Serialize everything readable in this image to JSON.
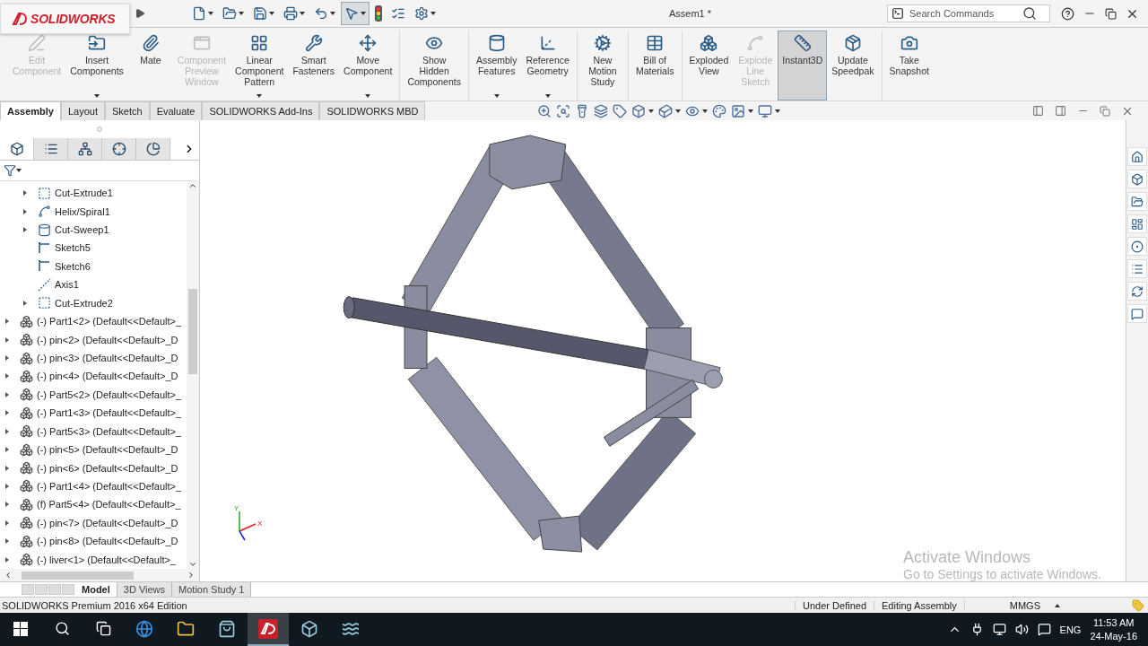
{
  "logo": "SOLIDWORKS",
  "title": "Assem1 *",
  "search": {
    "placeholder": "Search Commands"
  },
  "quick_tools": [
    {
      "kind": "new",
      "menu": true,
      "selected": false
    },
    {
      "kind": "open",
      "menu": true,
      "selected": false
    },
    {
      "kind": "save",
      "menu": true,
      "selected": false
    },
    {
      "kind": "print",
      "menu": true,
      "selected": false
    },
    {
      "kind": "undo",
      "menu": true,
      "selected": false
    },
    {
      "kind": "select",
      "menu": true,
      "selected": true
    },
    {
      "kind": "rebuild",
      "menu": false,
      "selected": false
    },
    {
      "kind": "options-list",
      "menu": false,
      "selected": false
    },
    {
      "kind": "settings",
      "menu": true,
      "selected": false
    }
  ],
  "ribbon_groups": [
    {
      "buttons": [
        {
          "label": "Edit Component",
          "kind": "edit",
          "disabled": true,
          "menu": false,
          "selected": false
        },
        {
          "label": "Insert Components",
          "kind": "insert",
          "disabled": false,
          "menu": true,
          "selected": false
        },
        {
          "label": "Mate",
          "kind": "mate",
          "disabled": false,
          "menu": false,
          "selected": false
        },
        {
          "label": "Component Preview Window",
          "kind": "preview",
          "disabled": true,
          "menu": false,
          "selected": false
        },
        {
          "label": "Linear Component Pattern",
          "kind": "pattern",
          "disabled": false,
          "menu": true,
          "selected": false
        },
        {
          "label": "Smart Fasteners",
          "kind": "fasteners",
          "disabled": false,
          "menu": false,
          "selected": false
        },
        {
          "label": "Move Component",
          "kind": "move",
          "disabled": false,
          "menu": true,
          "selected": false
        }
      ]
    },
    {
      "buttons": [
        {
          "label": "Show Hidden Components",
          "kind": "hidden",
          "disabled": false,
          "menu": false,
          "selected": false
        }
      ]
    },
    {
      "buttons": [
        {
          "label": "Assembly Features",
          "kind": "features",
          "disabled": false,
          "menu": true,
          "selected": false
        },
        {
          "label": "Reference Geometry",
          "kind": "geometry",
          "disabled": false,
          "menu": true,
          "selected": false
        }
      ]
    },
    {
      "buttons": [
        {
          "label": "New Motion Study",
          "kind": "motion",
          "disabled": false,
          "menu": false,
          "selected": false
        }
      ]
    },
    {
      "buttons": [
        {
          "label": "Bill of Materials",
          "kind": "bom",
          "disabled": false,
          "menu": false,
          "selected": false
        }
      ]
    },
    {
      "buttons": [
        {
          "label": "Exploded View",
          "kind": "explode",
          "disabled": false,
          "menu": false,
          "selected": false
        },
        {
          "label": "Explode Line Sketch",
          "kind": "explodeline",
          "disabled": true,
          "menu": false,
          "selected": false
        },
        {
          "label": "Instant3D",
          "kind": "instant3d",
          "disabled": false,
          "menu": false,
          "selected": true
        },
        {
          "label": "Update Speedpak",
          "kind": "speedpak",
          "disabled": false,
          "menu": false,
          "selected": false
        }
      ]
    },
    {
      "buttons": [
        {
          "label": "Take Snapshot",
          "kind": "snapshot",
          "disabled": false,
          "menu": false,
          "selected": false
        }
      ]
    }
  ],
  "command_tabs": [
    {
      "label": "Assembly",
      "selected": true
    },
    {
      "label": "Layout",
      "selected": false
    },
    {
      "label": "Sketch",
      "selected": false
    },
    {
      "label": "Evaluate",
      "selected": false
    },
    {
      "label": "SOLIDWORKS Add-Ins",
      "selected": false
    },
    {
      "label": "SOLIDWORKS MBD",
      "selected": false
    }
  ],
  "panel_tabs": [
    {
      "kind": "feature-manager",
      "selected": true
    },
    {
      "kind": "property-manager",
      "selected": false
    },
    {
      "kind": "configuration-manager",
      "selected": false
    },
    {
      "kind": "dimxpert",
      "selected": false
    },
    {
      "kind": "display-manager",
      "selected": false
    }
  ],
  "tree": {
    "features": [
      {
        "label": "Cut-Extrude1",
        "kind": "cut",
        "expandable": true
      },
      {
        "label": "Helix/Spiral1",
        "kind": "helix",
        "expandable": true
      },
      {
        "label": "Cut-Sweep1",
        "kind": "sweep",
        "expandable": true
      },
      {
        "label": "Sketch5",
        "kind": "sketch",
        "expandable": false
      },
      {
        "label": "Sketch6",
        "kind": "sketch",
        "expandable": false
      },
      {
        "label": "Axis1",
        "kind": "axis",
        "expandable": false
      },
      {
        "label": "Cut-Extrude2",
        "kind": "cut",
        "expandable": true
      }
    ],
    "components": [
      {
        "label": "(-) Part1<2> (Default<<Default>_",
        "expandable": true
      },
      {
        "label": "(-) pin<2> (Default<<Default>_D",
        "expandable": true
      },
      {
        "label": "(-) pin<3> (Default<<Default>_D",
        "expandable": true
      },
      {
        "label": "(-) pin<4> (Default<<Default>_D",
        "expandable": true
      },
      {
        "label": "(-) Part5<2> (Default<<Default>_",
        "expandable": true
      },
      {
        "label": "(-) Part1<3> (Default<<Default>_",
        "expandable": true
      },
      {
        "label": "(-) Part5<3> (Default<<Default>_",
        "expandable": true
      },
      {
        "label": "(-) pin<5> (Default<<Default>_D",
        "expandable": true
      },
      {
        "label": "(-) pin<6> (Default<<Default>_D",
        "expandable": true
      },
      {
        "label": "(-) Part1<4> (Default<<Default>_",
        "expandable": true
      },
      {
        "label": "(f) Part5<4> (Default<<Default>_",
        "expandable": true
      },
      {
        "label": "(-) pin<7> (Default<<Default>_D",
        "expandable": true
      },
      {
        "label": "(-) pin<8> (Default<<Default>_D",
        "expandable": true
      },
      {
        "label": "(-) liver<1> (Default<<Default>_",
        "expandable": true
      }
    ]
  },
  "view_tools": [
    {
      "kind": "zoom-fit",
      "menu": false
    },
    {
      "kind": "zoom-area",
      "menu": false
    },
    {
      "kind": "previous-view",
      "menu": false
    },
    {
      "kind": "section-view",
      "menu": false
    },
    {
      "kind": "dynamic-annotation",
      "menu": false
    },
    {
      "kind": "view-orientation",
      "menu": true
    },
    {
      "kind": "display-style",
      "menu": true
    },
    {
      "kind": "hide-show",
      "menu": true
    },
    {
      "kind": "edit-appearance",
      "menu": false
    },
    {
      "kind": "apply-scene",
      "menu": true
    },
    {
      "kind": "view-settings",
      "menu": true
    }
  ],
  "task_pane": [
    {
      "kind": "home"
    },
    {
      "kind": "resources"
    },
    {
      "kind": "design-library"
    },
    {
      "kind": "file-explorer"
    },
    {
      "kind": "appearances"
    },
    {
      "kind": "custom-properties"
    },
    {
      "kind": "recovery"
    },
    {
      "kind": "forum"
    }
  ],
  "triad": {
    "y": "Y",
    "x": "X"
  },
  "bottom_tabs": [
    {
      "label": "Model",
      "selected": true
    },
    {
      "label": "3D Views",
      "selected": false
    },
    {
      "label": "Motion Study 1",
      "selected": false
    }
  ],
  "status": {
    "edition": "SOLIDWORKS Premium 2016 x64 Edition",
    "fields": [
      "Under Defined",
      "Editing Assembly",
      "MMGS"
    ]
  },
  "watermark": {
    "title": "Activate Windows",
    "subtitle": "Go to Settings to activate Windows."
  },
  "taskbar": {
    "apps": [
      {
        "kind": "edge",
        "active": false
      },
      {
        "kind": "explorer",
        "active": false
      },
      {
        "kind": "store",
        "active": false
      },
      {
        "kind": "solidworks",
        "active": true
      },
      {
        "kind": "app-cube",
        "active": false
      },
      {
        "kind": "app-wave",
        "active": false
      }
    ],
    "language": "ENG",
    "time": "11:53 AM",
    "date": "24-May-16"
  }
}
